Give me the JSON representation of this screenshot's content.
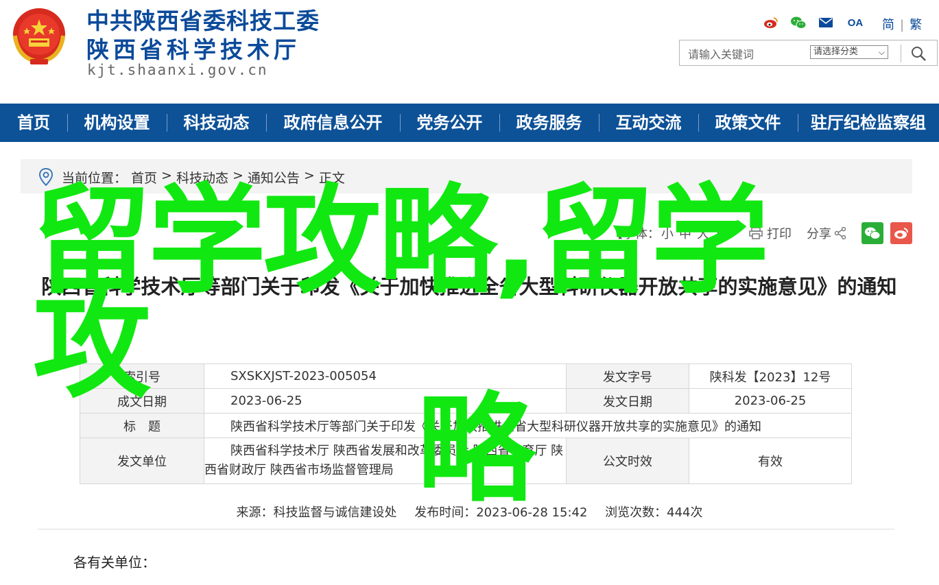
{
  "header": {
    "site_name_line1": "中共陕西省委科技工委",
    "site_name_line2": "陕西省科学技术厅",
    "domain": "kjt.shaanxi.gov.cn",
    "top_icons": [
      "weibo-icon",
      "wechat-icon",
      "mail-icon",
      "oa-icon"
    ],
    "oa_label": "OA",
    "lang_simplified": "简",
    "lang_separator": "|",
    "lang_traditional": "繁",
    "search_placeholder": "请输入关键词",
    "category_label": "请选择分类"
  },
  "nav": {
    "items": [
      "首页",
      "机构设置",
      "科技动态",
      "政府信息公开",
      "党务公开",
      "政务服务",
      "互动交流",
      "政策文件",
      "驻厅纪检监察组"
    ]
  },
  "breadcrumb": {
    "prefix": "当前位置：",
    "items": [
      "首页",
      "科技动态",
      "通知公告",
      "正文"
    ],
    "separator": ">"
  },
  "toolbar": {
    "font_size_label": "【字体：",
    "font_small": "小",
    "font_medium": "中",
    "font_large": "大",
    "font_close": "】",
    "print_label": "打印",
    "share_label": "分享"
  },
  "overlay": {
    "line1": "留学攻略,留学攻",
    "line2": "略"
  },
  "article": {
    "title": "陕西省科学技术厅等部门关于印发《关于加快推进全省大型科研仪器开放共享的实施意见》的通知"
  },
  "info_table": {
    "index_label": "索引号",
    "index_value": "SXSKXJST-2023-005054",
    "doc_no_label": "发文字号",
    "doc_no_value": "陕科发【2023】12号",
    "written_date_label": "成文日期",
    "written_date_value": "2023-06-25",
    "issue_date_label": "发文日期",
    "issue_date_value": "2023-06-25",
    "subject_label": "标　题",
    "subject_value": "陕西省科学技术厅等部门关于印发《关于加快推进全省大型科研仪器开放共享的实施意见》的通知",
    "unit_label": "发文单位",
    "unit_value": "陕西省科学技术厅 陕西省发展和改革委员会 陕西省教育厅 陕西省财政厅 陕西省市场监督管理局",
    "validity_label": "公文时效",
    "validity_value": "有效"
  },
  "meta": {
    "source": "来源：科技监督与诚信建设处",
    "publish_time": "发布时间：2023-06-28 15:42",
    "views": "浏览次数：444次"
  },
  "body": {
    "salutation": "各有关单位："
  },
  "colors": {
    "nav_bg": "#0d5197",
    "brand_blue": "#0b4a9a",
    "overlay_green": "#11e811"
  }
}
